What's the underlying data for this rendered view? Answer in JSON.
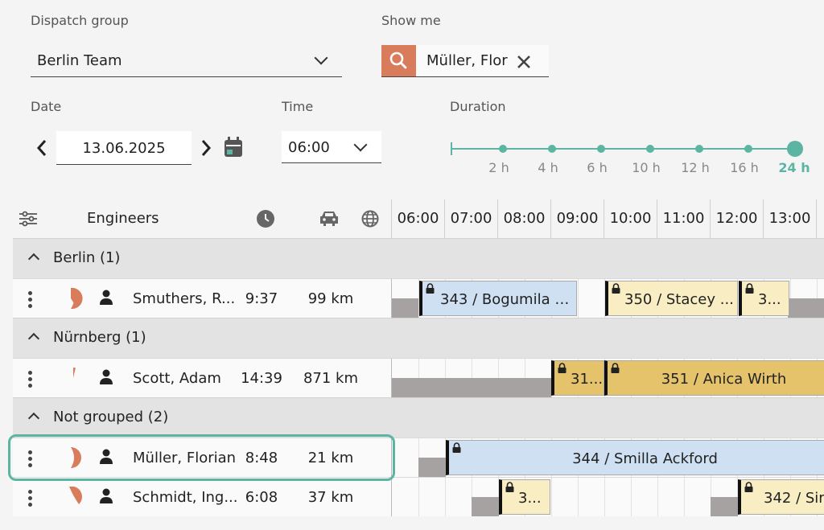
{
  "filters": {
    "dispatch_group": {
      "label": "Dispatch group",
      "value": "Berlin Team"
    },
    "show_me": {
      "label": "Show me",
      "value": "Müller, Flor"
    },
    "date": {
      "label": "Date",
      "value": "13.06.2025"
    },
    "time": {
      "label": "Time",
      "value": "06:00"
    },
    "duration": {
      "label": "Duration",
      "options": [
        "2 h",
        "4 h",
        "6 h",
        "10 h",
        "12 h",
        "16 h",
        "24 h"
      ],
      "selected": "24 h"
    }
  },
  "grid": {
    "engineers_label": "Engineers",
    "hours": [
      "06:00",
      "07:00",
      "08:00",
      "09:00",
      "10:00",
      "11:00",
      "12:00",
      "13:00"
    ],
    "groups": [
      {
        "label": "Berlin (1)",
        "engineers": [
          {
            "name": "Smuthers, R...",
            "time": "9:37",
            "distance": "99 km",
            "load": 0.42,
            "jobs": [
              {
                "label": "343 / Bogumila G...",
                "color": "blue"
              },
              {
                "label": "350 / Stacey ...",
                "color": "yellow"
              },
              {
                "label": "3...",
                "color": "yellow"
              }
            ]
          }
        ]
      },
      {
        "label": "Nürnberg (1)",
        "engineers": [
          {
            "name": "Scott, Adam",
            "time": "14:39",
            "distance": "871 km",
            "load": 0.04,
            "jobs": [
              {
                "label": "31...",
                "color": "gold"
              },
              {
                "label": "351 / Anica Wirth",
                "color": "gold"
              }
            ]
          }
        ]
      },
      {
        "label": "Not grouped (2)",
        "engineers": [
          {
            "name": "Müller, Florian",
            "time": "8:48",
            "distance": "21 km",
            "load": 0.45,
            "jobs": [
              {
                "label": "344 / Smilla Ackford",
                "color": "blue"
              }
            ]
          },
          {
            "name": "Schmidt, Ing...",
            "time": "6:08",
            "distance": "37 km",
            "load": 0.33,
            "jobs": [
              {
                "label": "3...",
                "color": "yellow"
              },
              {
                "label": "342 / Sir",
                "color": "yellow"
              }
            ]
          }
        ]
      }
    ]
  },
  "colors": {
    "accent": "#5bb5a2",
    "search": "#d97c5c",
    "pie": "#d97c5c",
    "blue_job": "#cfe0f3",
    "yellow_job": "#f8edc3",
    "gold_job": "#e4c36a",
    "unavailable": "#a7a2a2"
  }
}
